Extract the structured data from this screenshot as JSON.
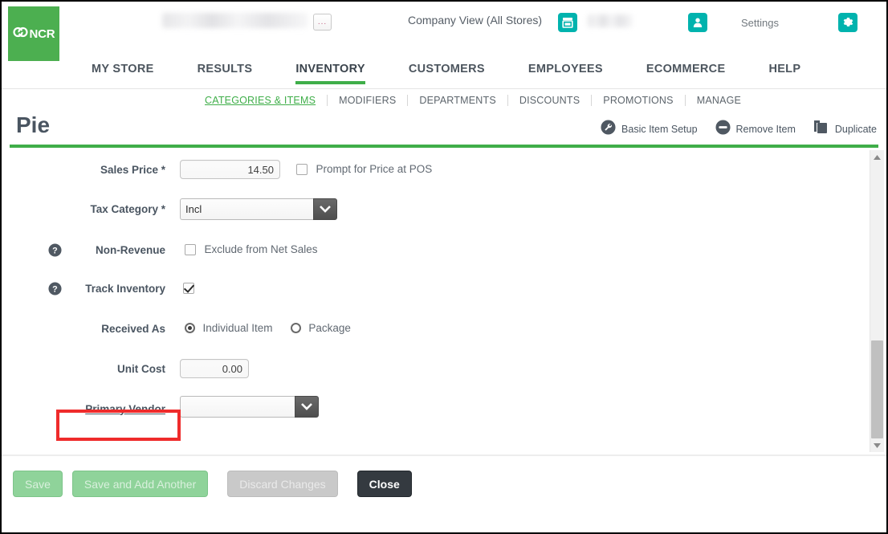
{
  "header": {
    "logo_text": "NCR",
    "logo_icon": "ncr-linked-rings-logo",
    "store_name_redacted": "",
    "ellipsis_button_label": "...",
    "company_view_label": "Company View (All Stores)",
    "store_icon": "store-icon",
    "store_value_redacted": "",
    "person_icon": "person-icon",
    "settings_label": "Settings",
    "gear_icon": "gear-icon",
    "accent_green": "#3fae49",
    "accent_teal": "#00b3ae"
  },
  "main_nav": {
    "items": [
      {
        "label": "MY STORE",
        "active": false
      },
      {
        "label": "RESULTS",
        "active": false
      },
      {
        "label": "INVENTORY",
        "active": true
      },
      {
        "label": "CUSTOMERS",
        "active": false
      },
      {
        "label": "EMPLOYEES",
        "active": false
      },
      {
        "label": "ECOMMERCE",
        "active": false
      },
      {
        "label": "HELP",
        "active": false
      }
    ]
  },
  "sub_nav": {
    "items": [
      {
        "label": "CATEGORIES & ITEMS",
        "active": true
      },
      {
        "label": "MODIFIERS",
        "active": false
      },
      {
        "label": "DEPARTMENTS",
        "active": false
      },
      {
        "label": "DISCOUNTS",
        "active": false
      },
      {
        "label": "PROMOTIONS",
        "active": false
      },
      {
        "label": "MANAGE",
        "active": false
      }
    ]
  },
  "title_row": {
    "page_title": "Pie",
    "tools": [
      {
        "label": "Basic Item Setup",
        "icon": "wrench-icon"
      },
      {
        "label": "Remove Item",
        "icon": "minus-circle-icon"
      },
      {
        "label": "Duplicate",
        "icon": "copy-icon"
      }
    ]
  },
  "form": {
    "sales_price": {
      "label": "Sales Price *",
      "value": "14.50",
      "checkbox_label": "Prompt for Price at POS",
      "checkbox_checked": false
    },
    "tax_category": {
      "label": "Tax Category *",
      "value": "Incl"
    },
    "non_revenue": {
      "label": "Non-Revenue",
      "help_icon": "help-icon",
      "checkbox_label": "Exclude from Net Sales",
      "checkbox_checked": false
    },
    "track_inventory": {
      "label": "Track Inventory",
      "help_icon": "help-icon",
      "checkbox_checked": true
    },
    "received_as": {
      "label": "Received As",
      "options": [
        {
          "label": "Individual Item",
          "selected": true
        },
        {
          "label": "Package",
          "selected": false
        }
      ]
    },
    "unit_cost": {
      "label": "Unit Cost",
      "value": "0.00"
    },
    "primary_vendor": {
      "label": "Primary Vendor",
      "value": "",
      "highlight_color": "#ef2b2b"
    }
  },
  "scrollbar": {
    "up_arrow": "scroll-up-arrow",
    "down_arrow": "scroll-down-arrow"
  },
  "footer": {
    "buttons": [
      {
        "label": "Save",
        "style": "green-disabled"
      },
      {
        "label": "Save and Add Another",
        "style": "green-disabled"
      },
      {
        "label": "Discard Changes",
        "style": "gray-disabled"
      },
      {
        "label": "Close",
        "style": "dark"
      }
    ]
  }
}
